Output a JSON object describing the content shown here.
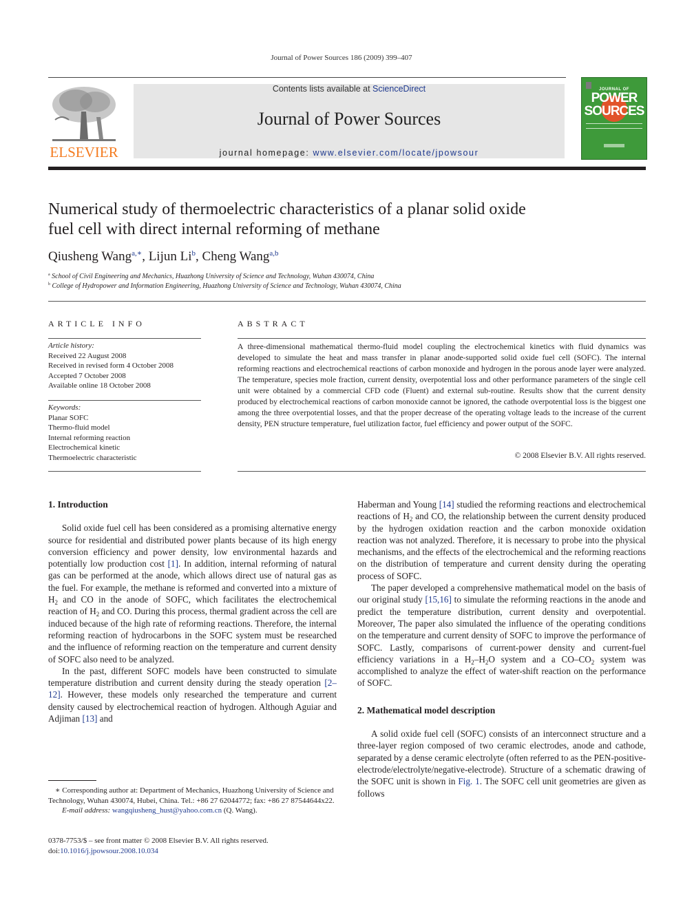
{
  "running_head": "Journal of Power Sources 186 (2009) 399–407",
  "header": {
    "publisher": "ELSEVIER",
    "contents_prefix": "Contents lists available at ",
    "contents_link": "ScienceDirect",
    "journal_title": "Journal of Power Sources",
    "homepage_prefix": "journal homepage: ",
    "homepage_link": "www.elsevier.com/locate/jpowsour",
    "cover": {
      "top": "JOURNAL OF",
      "line1": "POWER",
      "line2": "SOURCES",
      "color": "#3e9a3a",
      "accent": "#e1532a"
    },
    "publisher_color": "#f47b20",
    "link_color": "#1f3a8f"
  },
  "article": {
    "title_line1": "Numerical study of thermoelectric characteristics of a planar solid oxide",
    "title_line2": "fuel cell with direct internal reforming of methane",
    "authors": [
      {
        "name": "Qiusheng Wang",
        "marks": "a,∗"
      },
      {
        "name": "Lijun Li",
        "marks": "b"
      },
      {
        "name": "Cheng Wang",
        "marks": "a,b"
      }
    ],
    "affiliations": [
      {
        "mark": "a",
        "text": "School of Civil Engineering and Mechanics, Huazhong University of Science and Technology, Wuhan 430074, China"
      },
      {
        "mark": "b",
        "text": "College of Hydropower and Information Engineering, Huazhong University of Science and Technology, Wuhan 430074, China"
      }
    ]
  },
  "article_info": {
    "heading": "ARTICLE INFO",
    "history_label": "Article history:",
    "history": [
      "Received 22 August 2008",
      "Received in revised form 4 October 2008",
      "Accepted 7 October 2008",
      "Available online 18 October 2008"
    ],
    "keywords_label": "Keywords:",
    "keywords": [
      "Planar SOFC",
      "Thermo-fluid model",
      "Internal reforming reaction",
      "Electrochemical kinetic",
      "Thermoelectric characteristic"
    ]
  },
  "abstract": {
    "heading": "ABSTRACT",
    "text": "A three-dimensional mathematical thermo-fluid model coupling the electrochemical kinetics with fluid dynamics was developed to simulate the heat and mass transfer in planar anode-supported solid oxide fuel cell (SOFC). The internal reforming reactions and electrochemical reactions of carbon monoxide and hydrogen in the porous anode layer were analyzed. The temperature, species mole fraction, current density, overpotential loss and other performance parameters of the single cell unit were obtained by a commercial CFD code (Fluent) and external sub-routine. Results show that the current density produced by electrochemical reactions of carbon monoxide cannot be ignored, the cathode overpotential loss is the biggest one among the three overpotential losses, and that the proper decrease of the operating voltage leads to the increase of the current density, PEN structure temperature, fuel utilization factor, fuel efficiency and power output of the SOFC.",
    "copyright": "© 2008 Elsevier B.V. All rights reserved."
  },
  "section1": {
    "heading": "1.  Introduction",
    "p1_a": "Solid oxide fuel cell has been considered as a promising alternative energy source for residential and distributed power plants because of its high energy conversion efficiency and power density, low environmental hazards and potentially low production cost ",
    "p1_ref1": "[1]",
    "p1_b": ". In addition, internal reforming of natural gas can be performed at the anode, which allows direct use of natural gas as the fuel. For example, the methane is reformed and converted into a mixture of H",
    "p1_c": " and CO in the anode of SOFC, which facilitates the electrochemical reaction of H",
    "p1_d": " and CO. During this process, thermal gradient across the cell are induced because of the high rate of reforming reactions. Therefore, the internal reforming reaction of hydrocarbons in the SOFC system must be researched and the influence of reforming reaction on the temperature and current density of SOFC also need to be analyzed.",
    "p2_a": "In the past, different SOFC models have been constructed to simulate temperature distribution and current density during the steady operation ",
    "p2_ref": "[2–12]",
    "p2_b": ". However, these models only researched the temperature and current density caused by electrochemical reaction of hydrogen. Although Aguiar and Adjiman ",
    "p2_ref2": "[13]",
    "p2_c": " and",
    "p3_a": "Haberman and Young ",
    "p3_ref": "[14]",
    "p3_b": " studied the reforming reactions and electrochemical reactions of H",
    "p3_c": " and CO, the relationship between the current density produced by the hydrogen oxidation reaction and the carbon monoxide oxidation reaction was not analyzed. Therefore, it is necessary to probe into the physical mechanisms, and the effects of the electrochemical and the reforming reactions on the distribution of temperature and current density during the operating process of SOFC.",
    "p4_a": "The paper developed a comprehensive mathematical model on the basis of our original study ",
    "p4_ref": "[15,16]",
    "p4_b": " to simulate the reforming reactions in the anode and predict the temperature distribution, current density and overpotential. Moreover, The paper also simulated the influence of the operating conditions on the temperature and current density of SOFC to improve the performance of SOFC. Lastly, comparisons of current-power density and current-fuel efficiency variations in a H",
    "p4_c": "–H",
    "p4_d": "O system and a CO–CO",
    "p4_e": " system was accomplished to analyze the effect of water-shift reaction on the performance of SOFC.",
    "sub2": "2"
  },
  "section2": {
    "heading": "2.  Mathematical model description",
    "p1_a": "A solid oxide fuel cell (SOFC) consists of an interconnect structure and a three-layer region composed of two ceramic electrodes, anode and cathode, separated by a dense ceramic electrolyte (often referred to as the PEN-positive-electrode/electrolyte/negative-electrode). Structure of a schematic drawing of the SOFC unit is shown in ",
    "p1_ref": "Fig. 1",
    "p1_b": ". The SOFC cell unit geometries are given as follows"
  },
  "footnote": {
    "star": "∗",
    "text": " Corresponding author at: Department of Mechanics, Huazhong University of Science and Technology, Wuhan 430074, Hubei, China. Tel.: +86 27 62044772; fax: +86 27 87544644x22.",
    "email_label": "E-mail address: ",
    "email": "wangqiusheng_hust@yahoo.com.cn",
    "email_suffix": " (Q. Wang).",
    "issn": "0378-7753/$ – see front matter © 2008 Elsevier B.V. All rights reserved.",
    "doi_label": "doi:",
    "doi": "10.1016/j.jpowsour.2008.10.034"
  }
}
